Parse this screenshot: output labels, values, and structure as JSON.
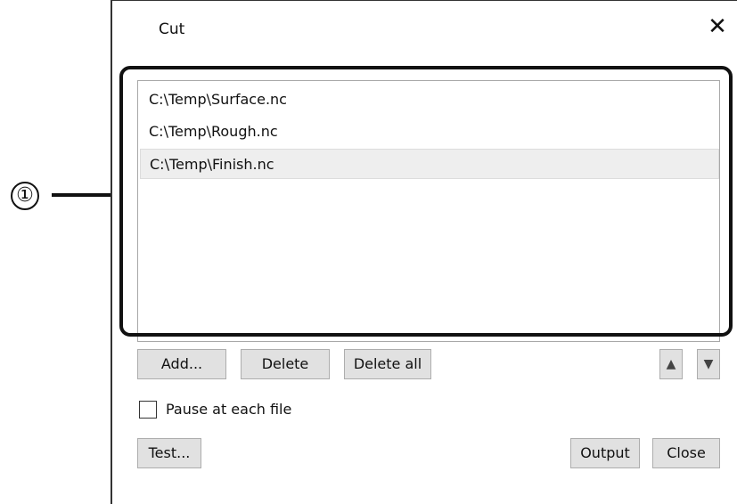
{
  "callout": {
    "number": "①"
  },
  "dialog": {
    "title": "Cut",
    "close_glyph": "✕"
  },
  "file_list": {
    "items": [
      {
        "path": "C:\\Temp\\Surface.nc",
        "selected": false
      },
      {
        "path": "C:\\Temp\\Rough.nc",
        "selected": false
      },
      {
        "path": "C:\\Temp\\Finish.nc",
        "selected": true
      }
    ]
  },
  "buttons": {
    "add": "Add...",
    "delete": "Delete",
    "delete_all": "Delete all",
    "move_up": "▲",
    "move_down": "▼",
    "test": "Test...",
    "output": "Output",
    "close": "Close"
  },
  "options": {
    "pause_label": "Pause at each file",
    "pause_checked": false
  }
}
